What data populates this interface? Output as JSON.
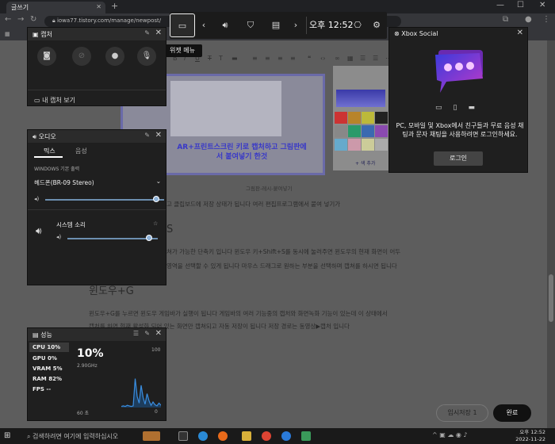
{
  "browser": {
    "tab_title": "글쓰기",
    "tab_close": "✕",
    "new_tab": "+",
    "url": "iowa77.tistory.com/manage/newpost/",
    "window_controls": [
      "—",
      "☐",
      "✕"
    ]
  },
  "gamebar": {
    "time": "오후 12:52",
    "tooltip": "위젯 메뉴"
  },
  "capture": {
    "title": "캡처",
    "view_captures": "내 캡처 보기"
  },
  "audio": {
    "title": "오디오",
    "tabs": [
      "믹스",
      "음성"
    ],
    "output_label": "WINDOWS 기본 출력",
    "device": "헤드폰(BR-09 Stereo)",
    "device_level": 0.93,
    "app_name": "시스템 소리",
    "app_level": 0.9
  },
  "perf": {
    "title": "성능",
    "rows": [
      {
        "label": "CPU",
        "value": "10%"
      },
      {
        "label": "GPU",
        "value": "0%"
      },
      {
        "label": "VRAM",
        "value": "5%"
      },
      {
        "label": "RAM",
        "value": "82%"
      },
      {
        "label": "FPS",
        "value": "--"
      }
    ],
    "big_value": "10%",
    "freq": "2.90GHz",
    "max": "100",
    "min": "0",
    "duration": "60 초",
    "graph_values": [
      2,
      3,
      2,
      4,
      3,
      2,
      3,
      52,
      20,
      8,
      40,
      18,
      6,
      25,
      12,
      4,
      10,
      5,
      3,
      8,
      4
    ]
  },
  "xbox": {
    "title": "Xbox Social",
    "message": "PC, 모바일 및 Xbox에서 친구들과 무료 음성 채팅과 문자 채팅을 사용하려면 로그인하세요.",
    "login": "로그인"
  },
  "page": {
    "image_caption": "AR+프린트스크린 키로 캡처하고 그림판에서 붙여넣기 한것",
    "figure_caption": "그림판-레시-붙여넣기",
    "line1": "고 클립보드에 저장 상태가 됩니다 여러 편집프로그램에서 붙여 넣기가",
    "heading1": "S",
    "para1a": "쳐가 가능한 단축키 입니다 윈도우 키+Shift+S를 동시에 눌러주면 윈도우의 현재  화면이 어두",
    "para1b": "영역을 선택할 수 있게 됩니다 마우스 드래그로 원하는 부분을 선택하며 캡쳐를 하시면 됩니다",
    "heading2": "윈도우+G",
    "para2a": "윈도우+G를 누르면 윈도우 게임바가 실행이 됩니다 게임바의 여러 기능중의 캡처와 화면녹화 기능이 있는데 이 상태에서",
    "para2b": "캡처를 하면 현재 활성화 되어 있는 화면만 캡쳐되고 자동 저장이 됩니다 저장 경로는 동영상▶캡처 입니다",
    "temp_save": "임시저장",
    "temp_count": "1",
    "publish": "완료",
    "palette_more": "+ 색 추가"
  },
  "taskbar": {
    "search_placeholder": "검색하려면 여기에 입력하십시오",
    "time": "오후 12:52",
    "date": "2022-11-22"
  }
}
